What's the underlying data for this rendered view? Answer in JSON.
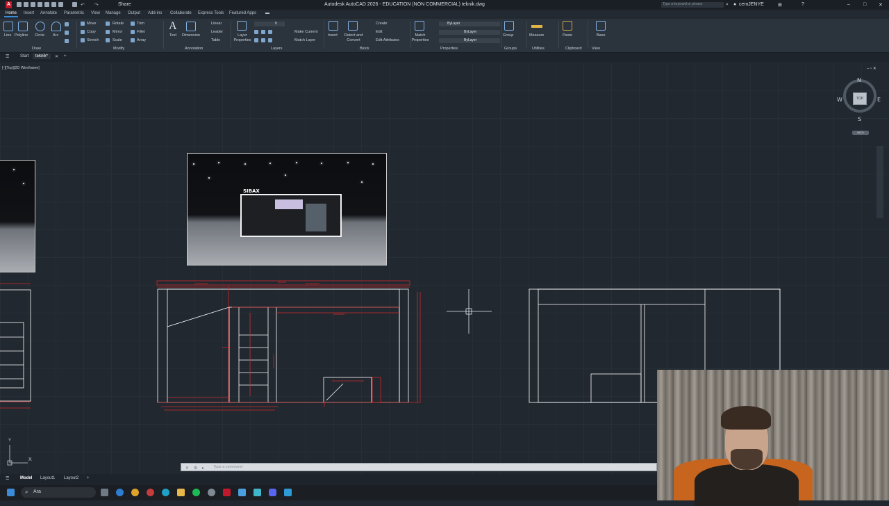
{
  "title_bar": {
    "title": "Autodesk AutoCAD 2026 - EDUCATION (NON COMMERCIAL)  teknik.dwg",
    "share": "Share",
    "search_placeholder": "Type a keyword or phrase",
    "user": "cemJENYE"
  },
  "ribbon_tabs": [
    "Home",
    "Insert",
    "Annotate",
    "Parametric",
    "View",
    "Manage",
    "Output",
    "Add-ins",
    "Collaborate",
    "Express Tools",
    "Featured Apps"
  ],
  "ribbon": {
    "draw": {
      "line": "Line",
      "polyline": "Polyline",
      "circle": "Circle",
      "arc": "Arc",
      "group": "Draw"
    },
    "modify": {
      "move": "Move",
      "copy": "Copy",
      "stretch": "Stretch",
      "rotate": "Rotate",
      "mirror": "Mirror",
      "scale": "Scale",
      "trim": "Trim",
      "fillet": "Fillet",
      "array": "Array",
      "group": "Modify"
    },
    "annotation": {
      "text": "Text",
      "dimension": "Dimension",
      "linear": "Linear",
      "leader": "Leader",
      "table": "Table",
      "group": "Annotation"
    },
    "layers": {
      "layer_properties": "Layer Properties",
      "current_layer": "0",
      "make_current": "Make Current",
      "match_layer": "Match Layer",
      "group": "Layers"
    },
    "block": {
      "insert": "Insert",
      "detect": "Detect and Convert",
      "create": "Create",
      "edit": "Edit",
      "edit_attributes": "Edit Attributes",
      "group": "Block"
    },
    "properties": {
      "match": "Match Properties",
      "bylayer1": "ByLayer",
      "bylayer2": "ByLayer",
      "bylayer3": "ByLayer",
      "group": "Properties"
    },
    "groups": {
      "group_btn": "Group",
      "group": "Groups"
    },
    "utilities": {
      "measure": "Measure",
      "group": "Utilities"
    },
    "clipboard": {
      "paste": "Paste",
      "group": "Clipboard"
    },
    "view": {
      "base": "Base",
      "group": "View"
    }
  },
  "file_tabs": {
    "start": "Start",
    "active": "teknik*"
  },
  "viewport": {
    "label": "[-][Top][2D Wireframe]",
    "compass": {
      "n": "N",
      "s": "S",
      "e": "E",
      "w": "W",
      "top": "TOP"
    },
    "wcs": "WCS",
    "ucs_y": "Y",
    "ucs_x": "X",
    "booth_logo": "SIBAX"
  },
  "command_line": {
    "placeholder": "Type a command"
  },
  "layout_tabs": [
    "Model",
    "Layout1",
    "Layout2"
  ],
  "taskbar": {
    "search": "Ara"
  },
  "colors": {
    "accent": "#3b8bd9",
    "canvas": "#212830",
    "red_lines": "#d12a2a"
  }
}
